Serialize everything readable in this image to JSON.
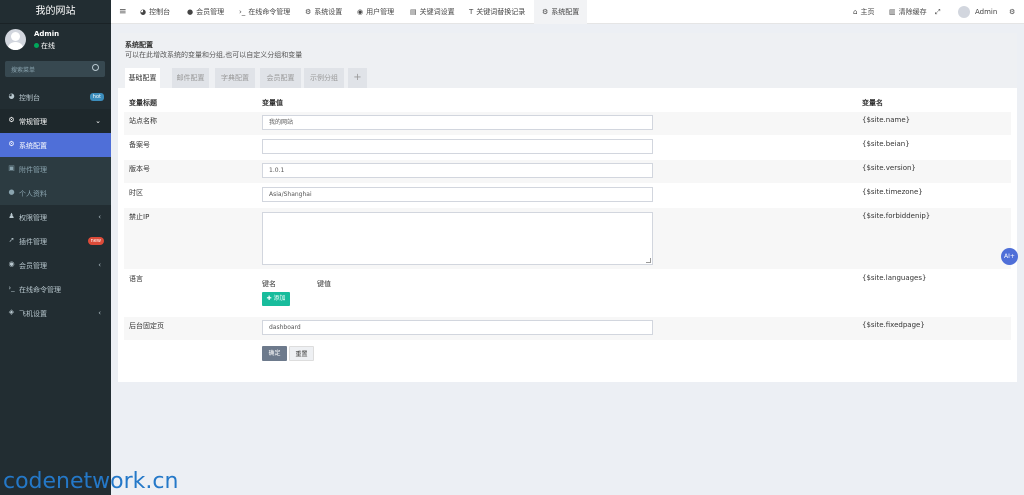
{
  "sidebar": {
    "site_name": "我的网站",
    "user_name": "Admin",
    "user_status": "在线",
    "search_placeholder": "搜索菜单",
    "items": [
      {
        "label": "控制台",
        "badge": "hot"
      },
      {
        "label": "常规管理"
      },
      {
        "label": "系统配置"
      },
      {
        "label": "附件管理"
      },
      {
        "label": "个人资料"
      },
      {
        "label": "权限管理"
      },
      {
        "label": "插件管理",
        "badge": "new"
      },
      {
        "label": "会员管理"
      },
      {
        "label": "在线命令管理"
      },
      {
        "label": "飞机设置"
      }
    ]
  },
  "topbar": {
    "tabs": [
      "控制台",
      "会员管理",
      "在线命令管理",
      "系统设置",
      "用户管理",
      "关键词设置",
      "关键词替换记录",
      "系统配置"
    ],
    "home": "主页",
    "clear_cache": "清除缓存",
    "user": "Admin"
  },
  "panel": {
    "title": "系统配置",
    "description": "可以在此增改系统的变量和分组,也可以自定义分组和变量",
    "tabs": [
      "基础配置",
      "邮件配置",
      "字典配置",
      "会员配置",
      "示例分组",
      "+"
    ]
  },
  "table": {
    "headers": [
      "变量标题",
      "变量值",
      "变量名"
    ],
    "rows": [
      {
        "title": "站点名称",
        "value": "我的网站",
        "name": "{$site.name}"
      },
      {
        "title": "备案号",
        "value": "",
        "name": "{$site.beian}"
      },
      {
        "title": "版本号",
        "value": "1.0.1",
        "name": "{$site.version}"
      },
      {
        "title": "时区",
        "value": "Asia/Shanghai",
        "name": "{$site.timezone}"
      },
      {
        "title": "禁止IP",
        "value": "",
        "name": "{$site.forbiddenip}"
      },
      {
        "title": "语言",
        "name": "{$site.languages}",
        "key_label": "键名",
        "value_label": "键值",
        "add_button": "添加"
      },
      {
        "title": "后台固定页",
        "value": "dashboard",
        "name": "{$site.fixedpage}"
      }
    ]
  },
  "buttons": {
    "submit": "确定",
    "reset": "重置"
  },
  "ai_button": "AI+",
  "watermark": "codenetwork.cn",
  "colors": {
    "sidebar": "#222d32",
    "active": "#4f6fd8",
    "success": "#18bc9c"
  }
}
